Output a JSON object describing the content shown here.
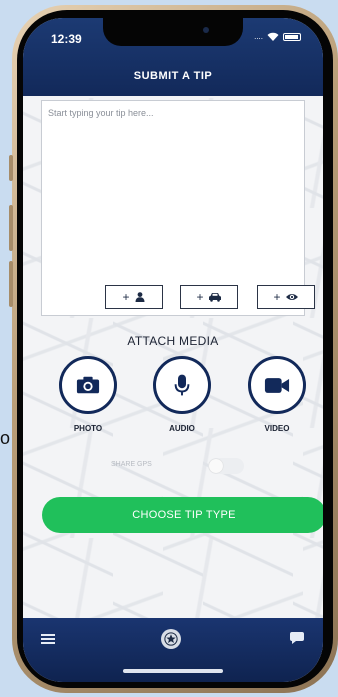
{
  "status_bar": {
    "time": "12:39",
    "signal": "...."
  },
  "header": {
    "title": "SUBMIT A TIP"
  },
  "tip": {
    "placeholder": "Start typing your tip here..."
  },
  "tag_buttons": [
    {
      "label": "+",
      "icon": "person-icon"
    },
    {
      "label": "+",
      "icon": "car-icon"
    },
    {
      "label": "+",
      "icon": "eye-icon"
    }
  ],
  "attach": {
    "title": "ATTACH MEDIA",
    "photo_label": "PHOTO",
    "audio_label": "AUDIO",
    "video_label": "VIDEO"
  },
  "gps": {
    "label": "SHARE GPS",
    "enabled": false
  },
  "cta": {
    "label": "CHOOSE TIP TYPE"
  },
  "colors": {
    "navy": "#12295a",
    "green": "#20c05b",
    "frame": "#b99e78"
  },
  "stray_text": "o"
}
